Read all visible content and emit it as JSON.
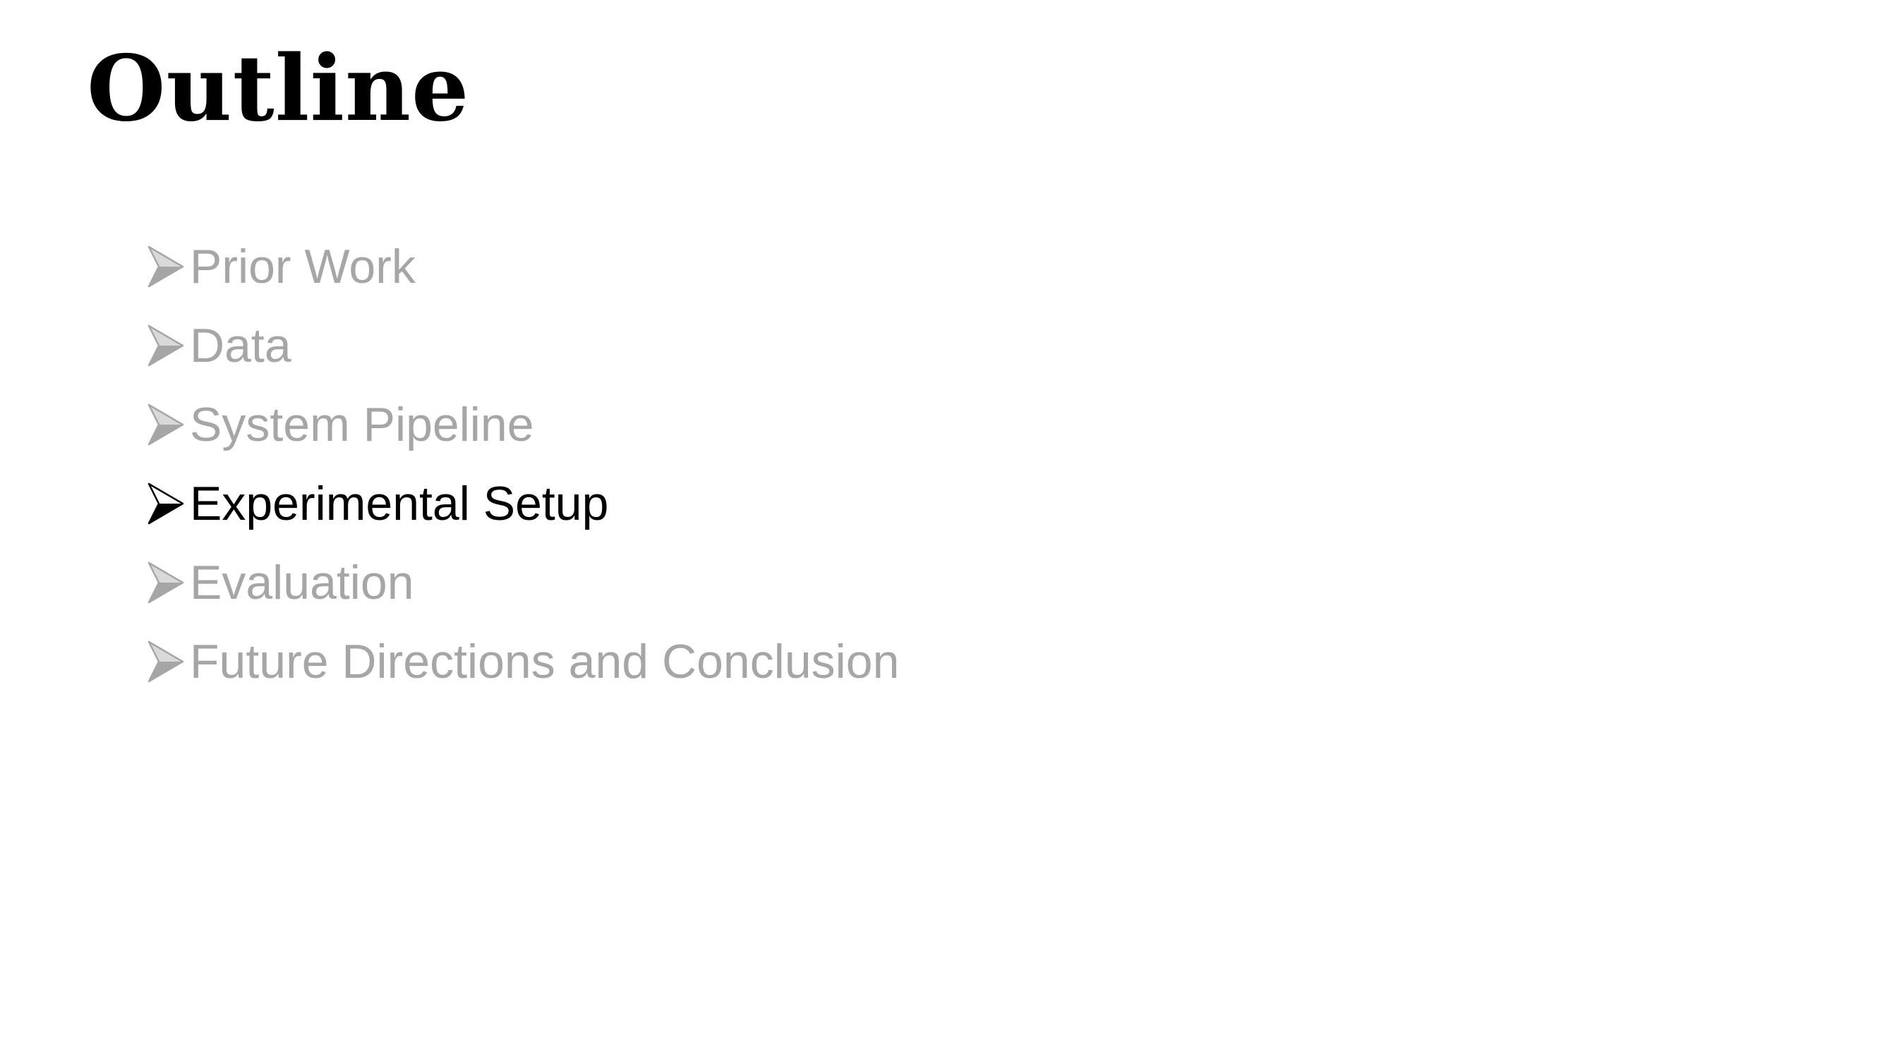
{
  "slide": {
    "title": "Outline",
    "items": [
      {
        "label": "Prior Work",
        "active": false,
        "bullet_icon": "arrowhead-bullet-icon"
      },
      {
        "label": "Data",
        "active": false,
        "bullet_icon": "arrowhead-bullet-icon"
      },
      {
        "label": "System Pipeline",
        "active": false,
        "bullet_icon": "arrowhead-bullet-icon"
      },
      {
        "label": "Experimental Setup",
        "active": true,
        "bullet_icon": "arrowhead-bullet-icon"
      },
      {
        "label": "Evaluation",
        "active": false,
        "bullet_icon": "arrowhead-bullet-icon"
      },
      {
        "label": "Future Directions and Conclusion",
        "active": false,
        "bullet_icon": "arrowhead-bullet-icon"
      }
    ],
    "colors": {
      "active_text": "#000000",
      "inactive_text": "#a6a6a6",
      "background": "#ffffff"
    }
  }
}
